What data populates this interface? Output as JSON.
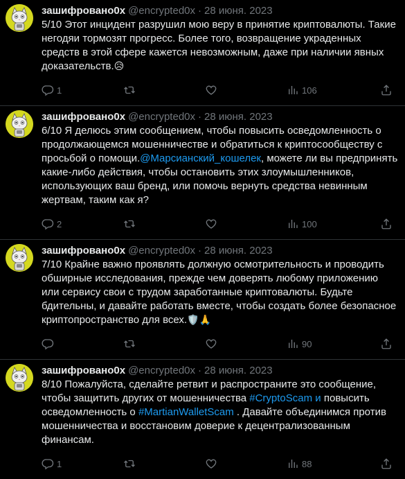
{
  "author": {
    "name": "зашифровано0x",
    "handle": "@encrypted0x",
    "separator": "·"
  },
  "tweets": [
    {
      "date": "28 июня. 2023",
      "text_parts": [
        {
          "t": "5/10 Этот инцидент разрушил мою веру в принятие криптовалюты. Такие негодяи тормозят прогресс. Более того, возвращение украденных средств в этой сфере кажется невозможным, даже при наличии явных доказательств."
        },
        {
          "t": "😥",
          "emoji": true
        }
      ],
      "replies": "1",
      "retweets": "",
      "likes": "",
      "views": "106"
    },
    {
      "date": "28 июня. 2023",
      "text_parts": [
        {
          "t": "6/10 Я делюсь этим сообщением, чтобы повысить осведомленность о продолжающемся мошенничестве и обратиться к криптосообществу с просьбой о помощи."
        },
        {
          "t": "@Марсианский_кошелек",
          "link": true
        },
        {
          "t": ", можете ли вы предпринять какие-либо действия, чтобы остановить этих злоумышленников, использующих ваш бренд, или помочь вернуть средства невинным жертвам, таким как я?"
        }
      ],
      "replies": "2",
      "retweets": "",
      "likes": "",
      "views": "100"
    },
    {
      "date": "28 июня. 2023",
      "text_parts": [
        {
          "t": "7/10 Крайне важно проявлять должную осмотрительность и проводить обширные исследования, прежде чем доверять любому приложению или сервису свои с трудом заработанные криптовалюты. Будьте бдительны, и давайте работать вместе, чтобы создать более безопасное криптопространство для всех."
        },
        {
          "t": "🛡️🙏",
          "emoji": true
        }
      ],
      "replies": "",
      "retweets": "",
      "likes": "",
      "views": "90"
    },
    {
      "date": "28 июня. 2023",
      "text_parts": [
        {
          "t": "8/10 Пожалуйста, сделайте ретвит и распространите это сообщение, чтобы защитить других от мошенничества "
        },
        {
          "t": "#CryptoScam",
          "link": true
        },
        {
          "t": " "
        },
        {
          "t": "и",
          "link": true
        },
        {
          "t": " повысить осведомленность о "
        },
        {
          "t": "#MartianWalletScam",
          "link": true
        },
        {
          "t": " . Давайте объединимся против мошенничества и восстановим доверие к децентрализованным финансам."
        }
      ],
      "replies": "1",
      "retweets": "",
      "likes": "",
      "views": "88"
    }
  ],
  "icons": {
    "reply": "reply-icon",
    "retweet": "retweet-icon",
    "like": "heart-icon",
    "views": "views-chart-icon",
    "share": "share-icon"
  },
  "colors": {
    "background": "#000000",
    "text": "#e7e9ea",
    "muted": "#71767b",
    "link": "#1d9bf0",
    "divider": "#2f3336",
    "avatar_bg": "#d4d820"
  }
}
